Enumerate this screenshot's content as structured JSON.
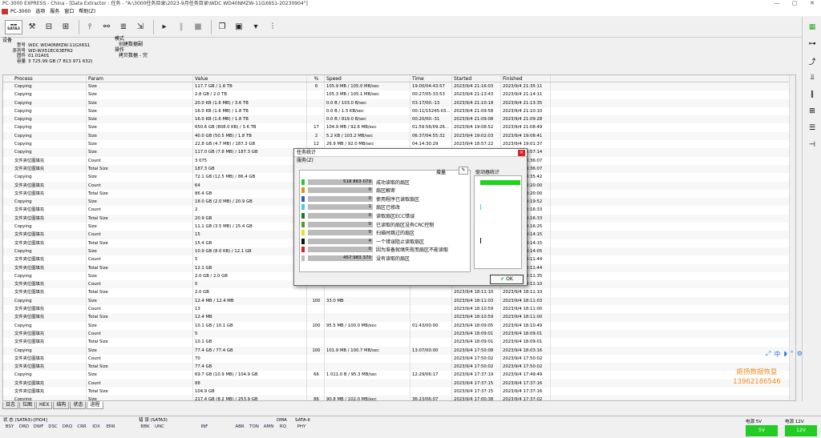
{
  "window": {
    "title": "PC-3000 EXPRESS - China - [Data Extractor : 任务 - \"A:\\3000任务目录\\2023-9月任务目录\\WDC WD40NMZW-11GX6S1-20230904\"]",
    "controls": [
      "—",
      "▢",
      "✕"
    ]
  },
  "menu": {
    "items": [
      "PC-3000",
      "选项",
      "服务",
      "窗口",
      "帮助(Z)"
    ]
  },
  "toolbar": {
    "sata_label": "SATA3",
    "icons": [
      "tools-icon",
      "layout-icon",
      "grid-icon",
      "pipe-icon",
      "binoculars-icon",
      "stack-icon",
      "export-icon",
      "play-icon",
      "pause-icon",
      "stop-icon",
      "copy-icon",
      "window-icon",
      "dropdown-icon",
      "signal-icon"
    ]
  },
  "device": {
    "section_label": "设备",
    "rows": [
      {
        "k": "型号",
        "v": "WDC WD40NMZW-11GX6S1"
      },
      {
        "k": "序列号",
        "v": "WD-WX51EC63EFR2"
      },
      {
        "k": "固件",
        "v": "01.01A01"
      },
      {
        "k": "容量",
        "v": "3 725.99 GB (7 813 971 632)"
      }
    ]
  },
  "mode": {
    "label": "模式",
    "value": "创建数据副",
    "op_label": "操作",
    "op_value": "拷贝数据 - 完"
  },
  "grid": {
    "headers": [
      "Process",
      "Param",
      "Value",
      "%",
      "Speed",
      "Time",
      "Started",
      "Finished"
    ],
    "rows": [
      [
        "Copying",
        "Size",
        "117.7 GB / 1.8 TB",
        "6",
        "105.9 MB / 105.0 MB/sec",
        "19:00/04:43:57",
        "2023/9/4 21:16:03",
        "2023/9/4 21:35:11"
      ],
      [
        "Copying",
        "Size",
        "2.8 GB / 2.0 TB",
        "",
        "105.3 MB / 105.1 MB/sec",
        "00:27/05:33:53",
        "2023/9/4 21:13:43",
        "2023/9/4 21:14:11"
      ],
      [
        "Copying",
        "Size",
        "20.0 KB (1.6 MB) / 3.6 TB",
        "",
        "0.0 B / 103.0 B/sec",
        "03:17/00:-13",
        "2023/9/4 21:10:18",
        "2023/9/4 21:13:35"
      ],
      [
        "Copying",
        "Size",
        "16.0 KB (1.6 MB) / 1.8 TB",
        "",
        "0.0 B / 1.5 KB/sec",
        "00:11/15245:03...",
        "2023/9/4 21:09:58",
        "2023/9/4 21:10:10"
      ],
      [
        "Copying",
        "Size",
        "16.0 KB (1.6 MB) / 1.8 TB",
        "",
        "0.0 B / 819.0 B/sec",
        "00:20/00:-31",
        "2023/9/4 21:09:08",
        "2023/9/4 21:09:28"
      ],
      [
        "Copying",
        "Size",
        "650.6 GB (808.0 KB) / 3.6 TB",
        "17",
        "104.9 MB / 92.6 MB/sec",
        "01:59:56/09:26...",
        "2023/9/4 19:08:52",
        "2023/9/4 21:08:49"
      ],
      [
        "Copying",
        "Size",
        "40.0 GB (50.5 MB) / 1.8 TB",
        "2",
        "5.2 KB / 103.2 MB/sec",
        "06:37/04:55:32",
        "2023/9/4 19:02:03",
        "2023/9/4 19:08:41"
      ],
      [
        "Copying",
        "Size",
        "22.8 GB (4.7 MB) / 187.3 GB",
        "12",
        "26.9 MB / 92.0 MB/sec",
        "04:14:30:29",
        "2023/9/4 18:57:22",
        "2023/9/4 19:01:37"
      ],
      [
        "Copying",
        "Size",
        "117.0 GB (7.8 MB) / 187.3 GB",
        "",
        "",
        "",
        "",
        "2023/9/4 18:57:14"
      ],
      [
        "文件夹位图填充",
        "Count",
        "3 075",
        "",
        "",
        "",
        "",
        "2023/9/4 18:36:07"
      ],
      [
        "文件夹位图填充",
        "Total Size",
        "187.3 GB",
        "",
        "",
        "",
        "",
        "2023/9/4 18:36:07"
      ],
      [
        "Copying",
        "Size",
        "72.1 GB (12.5 MB) / 86.4 GB",
        "",
        "",
        "",
        "",
        "2023/9/4 18:35:42"
      ],
      [
        "文件夹位图填充",
        "Count",
        "64",
        "",
        "",
        "",
        "",
        "2023/9/4 18:20:00"
      ],
      [
        "文件夹位图填充",
        "Total Size",
        "86.4 GB",
        "",
        "",
        "",
        "",
        "2023/9/4 18:20:00"
      ],
      [
        "Copying",
        "Size",
        "18.0 GB (2.0 MB) / 20.9 GB",
        "",
        "",
        "",
        "",
        "2023/9/4 18:19:52"
      ],
      [
        "文件夹位图填充",
        "Count",
        "2",
        "",
        "",
        "",
        "",
        "2023/9/4 18:16:33"
      ],
      [
        "文件夹位图填充",
        "Total Size",
        "20.9 GB",
        "",
        "",
        "",
        "",
        "2023/9/4 18:16:33"
      ],
      [
        "Copying",
        "Size",
        "11.1 GB (3.5 MB) / 15.4 GB",
        "",
        "",
        "",
        "",
        "2023/9/4 18:16:25"
      ],
      [
        "文件夹位图填充",
        "Count",
        "15",
        "",
        "",
        "",
        "",
        "2023/9/4 18:14:15"
      ],
      [
        "文件夹位图填充",
        "Total Size",
        "15.4 GB",
        "",
        "",
        "",
        "",
        "2023/9/4 18:14:15"
      ],
      [
        "Copying",
        "Size",
        "10.9 GB (8.0 KB) / 12.1 GB",
        "",
        "",
        "",
        "",
        "2023/9/4 18:14:05"
      ],
      [
        "文件夹位图填充",
        "Count",
        "5",
        "",
        "",
        "",
        "",
        "2023/9/4 18:11:44"
      ],
      [
        "文件夹位图填充",
        "Total Size",
        "12.1 GB",
        "",
        "",
        "",
        "",
        "2023/9/4 18:11:44"
      ],
      [
        "Copying",
        "Size",
        "2.0 GB / 2.0 GB",
        "",
        "",
        "",
        "",
        "2023/9/4 18:11:35"
      ],
      [
        "文件夹位图填充",
        "Count",
        "0",
        "",
        "",
        "",
        "",
        "2023/9/4 18:11:10"
      ],
      [
        "文件夹位图填充",
        "Total Size",
        "2.0 GB",
        "",
        "",
        "",
        "2023/9/4 18:11:10",
        "2023/9/4 18:11:10"
      ],
      [
        "Copying",
        "Size",
        "12.4 MB / 12.4 MB",
        "100",
        "33.0 MB",
        "",
        "2023/9/4 18:11:03",
        "2023/9/4 18:11:03"
      ],
      [
        "文件夹位图填充",
        "Count",
        "13",
        "",
        "",
        "",
        "2023/9/4 18:10:59",
        "2023/9/4 18:11:00"
      ],
      [
        "文件夹位图填充",
        "Total Size",
        "12.4 MB",
        "",
        "",
        "",
        "2023/9/4 18:10:59",
        "2023/9/4 18:11:00"
      ],
      [
        "Copying",
        "Size",
        "10.1 GB / 10.1 GB",
        "100",
        "95.5 MB / 100.0 MB/sec",
        "01:43/00:00",
        "2023/9/4 18:09:05",
        "2023/9/4 18:10:49"
      ],
      [
        "文件夹位图填充",
        "Count",
        "5",
        "",
        "",
        "",
        "2023/9/4 18:09:01",
        "2023/9/4 18:09:01"
      ],
      [
        "文件夹位图填充",
        "Total Size",
        "10.1 GB",
        "",
        "",
        "",
        "2023/9/4 18:09:01",
        "2023/9/4 18:09:01"
      ],
      [
        "Copying",
        "Size",
        "77.4 GB / 77.4 GB",
        "100",
        "101.9 MB / 100.7 MB/sec",
        "13:07/00:00",
        "2023/9/4 17:50:08",
        "2023/9/4 18:03:16"
      ],
      [
        "文件夹位图填充",
        "Count",
        "70",
        "",
        "",
        "",
        "2023/9/4 17:50:02",
        "2023/9/4 17:50:02"
      ],
      [
        "文件夹位图填充",
        "Total Size",
        "77.4 GB",
        "",
        "",
        "",
        "2023/9/4 17:50:02",
        "2023/9/4 17:50:02"
      ],
      [
        "Copying",
        "Size",
        "69.7 GB (10.9 MB) / 104.9 GB",
        "66",
        "1 011.0 B / 95.3 MB/sec",
        "12:29/06:17",
        "2023/9/4 17:37:19",
        "2023/9/4 17:49:49"
      ],
      [
        "文件夹位图填充",
        "Count",
        "88",
        "",
        "",
        "",
        "2023/9/4 17:37:15",
        "2023/9/4 17:37:16"
      ],
      [
        "文件夹位图填充",
        "Total Size",
        "104.9 GB",
        "",
        "",
        "",
        "2023/9/4 17:37:15",
        "2023/9/4 17:37:16"
      ],
      [
        "Copying",
        "Size",
        "217.4 GB (8.2 MB) / 253.9 GB",
        "86",
        "90.8 MB / 102.0 MB/sec",
        "36:23/06:07",
        "2023/9/4 17:00:38",
        "2023/9/4 17:37:02"
      ]
    ]
  },
  "tabs": [
    "日志",
    "位图",
    "HEX",
    "结构",
    "状态",
    "进程"
  ],
  "tabs_active_index": 5,
  "dialog": {
    "title": "任务统计",
    "close": "×",
    "menu": "服务(Z)",
    "increment_label": "增量",
    "drive_stats_label": "驱动器统计",
    "ok_label": "OK",
    "stats": [
      {
        "count": "518 863 079",
        "text": "成功读取的扇区",
        "color": "#22cc22"
      },
      {
        "count": "0",
        "text": "扇区解密",
        "color": "#e09020"
      },
      {
        "count": "0",
        "text": "使用程序已读取扇区",
        "color": "#2060d0"
      },
      {
        "count": "1",
        "text": "扇区已修改",
        "color": "#40d0e0"
      },
      {
        "count": "0",
        "text": "读取扇区ECC错误",
        "color": "#1f7a1f"
      },
      {
        "count": "0",
        "text": "已读取的扇区没有CRC控制",
        "color": "#5a9a2a"
      },
      {
        "count": "0",
        "text": "扫描时跳过的扇区",
        "color": "#e8e020"
      },
      {
        "count": "4",
        "text": "一个错误阻止读取扇区",
        "color": "#111111"
      },
      {
        "count": "0",
        "text": "因为准备就绪失败而扇区不能读取",
        "color": "#e02020"
      },
      {
        "count": "457 983 370",
        "text": "没有读取的扇区",
        "color": "#bbbbbb"
      }
    ]
  },
  "statusbar": {
    "groups": [
      {
        "title": "状 态 (SATA3)-[PIO4]",
        "cells": [
          "BSY",
          "DRD",
          "DWF",
          "DSC",
          "DRQ",
          "CRR",
          "IDX",
          "ERR"
        ]
      },
      {
        "title": "错 误 (SATA3)",
        "cells": [
          "BBK",
          "UNC",
          "",
          "INF",
          "",
          "ABR",
          "TON",
          "AMN"
        ]
      },
      {
        "title": "DMA",
        "cells": [
          "RQ"
        ]
      },
      {
        "title": "SATA-II",
        "cells": [
          "PHY"
        ]
      }
    ],
    "power": [
      {
        "title": "电源 5V",
        "value": "5V"
      },
      {
        "title": "电源 12V",
        "value": "12V"
      }
    ]
  },
  "watermark": {
    "line1": "姬扬数据恢复",
    "line2": "13962186546"
  },
  "zoomtools": [
    "⤢",
    "中",
    "◗",
    "°",
    "⚙"
  ]
}
